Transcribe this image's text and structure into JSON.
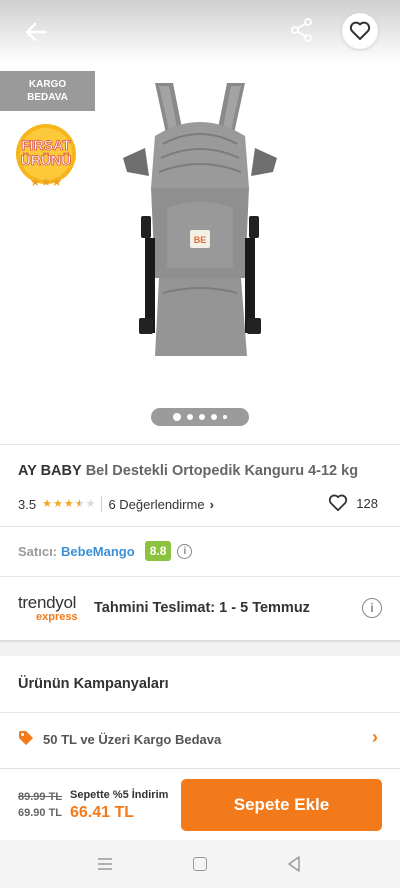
{
  "header": {
    "back_icon": "arrow-left-icon",
    "share_icon": "share-icon",
    "favorite_icon": "heart-outline-icon"
  },
  "badges": {
    "kargo_line1": "KARGO",
    "kargo_line2": "BEDAVA",
    "firsat_line1": "FIRSAT",
    "firsat_line2": "ÜRÜNÜ"
  },
  "gallery": {
    "product_image_logo": "BE",
    "page_count": 5,
    "active_page": 1
  },
  "product": {
    "brand": "AY BABY",
    "name": "Bel Destekli Ortopedik Kanguru 4-12 kg",
    "rating": "3.5",
    "rating_value": 3.5,
    "reviews": "6 Değerlendirme",
    "likes": "128"
  },
  "seller": {
    "label": "Satıcı:",
    "name": "BebeMango",
    "score": "8.8"
  },
  "delivery": {
    "logo_main": "trendyol",
    "logo_sub": "express",
    "label": "Tahmini Teslimat:",
    "dates": "1 - 5 Temmuz"
  },
  "campaigns": {
    "title": "Ürünün Kampanyaları",
    "items": [
      {
        "label": "50 TL ve Üzeri Kargo Bedava"
      }
    ]
  },
  "price": {
    "old": "89.99 TL",
    "current": "69.90 TL",
    "discount_label": "Sepette %5 İndirim",
    "final": "66.41 TL"
  },
  "actions": {
    "add_to_cart": "Sepete Ekle"
  },
  "colors": {
    "accent": "#f27a1a",
    "seller_link": "#3b8fd6",
    "seller_score": "#8cc23f",
    "star": "#f5a623"
  }
}
